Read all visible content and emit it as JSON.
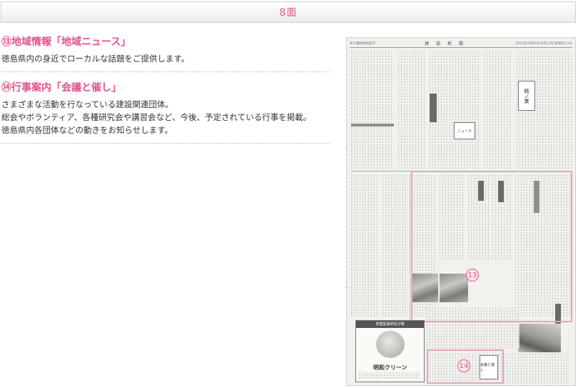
{
  "header": {
    "title": "8面"
  },
  "sections": [
    {
      "title": "⑬地域情報「地域ニュース」",
      "lines": [
        "徳島県内の身近でローカルな話題をご提供します。"
      ]
    },
    {
      "title": "⑭行事案内「会議と催し」",
      "lines": [
        "さまざまな活動を行なっている建設関連団体。",
        "総会やボランティア、各種研究会や講習会など、今後、予定されている行事を掲載。",
        "徳島県内各団体などの動きをお知らせします。"
      ]
    }
  ],
  "newspaper": {
    "masthead_name": "建 設 新 聞",
    "masthead_date": "2022年(令和4年)9月23日(金曜日)(10)",
    "masthead_left": "第三種郵便物認可",
    "feature_box_label": "精ノ業",
    "feature_box2_label": "ニュース",
    "ad_heading": "管理型最終処分場",
    "ad_company": "明和クリーン",
    "callout_13": "13",
    "callout_14": "14",
    "event_box_label": "会議と催し"
  },
  "colors": {
    "accent": "#e0538a",
    "highlight_border": "#e7a2bd"
  }
}
